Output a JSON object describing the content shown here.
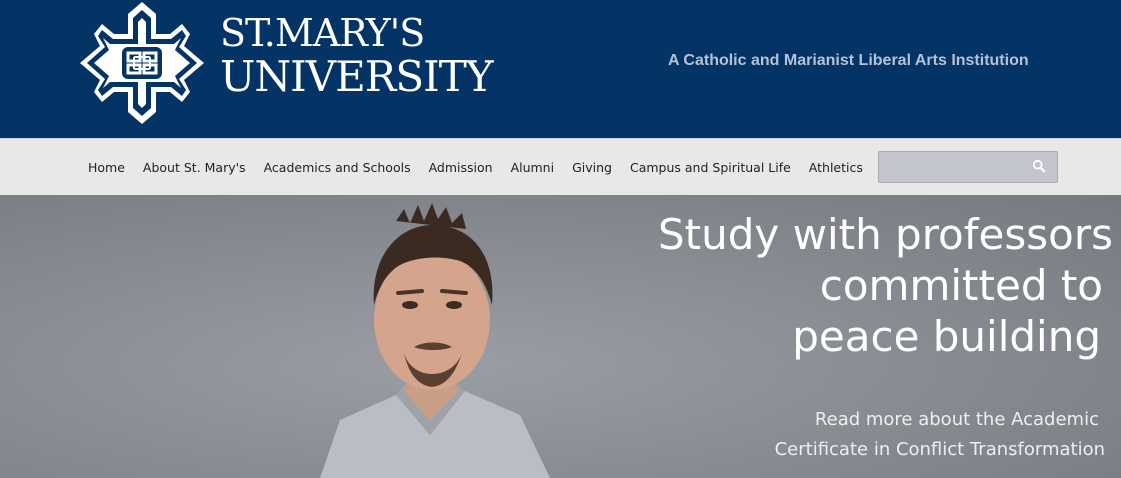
{
  "header": {
    "logo_line1": "ST.MARY'S",
    "logo_line2": "UNIVERSITY",
    "tagline": "A Catholic and Marianist Liberal Arts Institution",
    "crest_icon": "quatrefoil-cross-crest-icon"
  },
  "nav": {
    "items": [
      {
        "label": "Home"
      },
      {
        "label": "About St. Mary's"
      },
      {
        "label": "Academics and Schools"
      },
      {
        "label": "Admission"
      },
      {
        "label": "Alumni"
      },
      {
        "label": "Giving"
      },
      {
        "label": "Campus and Spiritual Life"
      },
      {
        "label": "Athletics"
      }
    ]
  },
  "search": {
    "placeholder": "",
    "value": "",
    "icon": "magnifier-icon"
  },
  "hero": {
    "headline_line1": "Study with professors",
    "headline_line2": "committed to",
    "headline_line3": "peace building",
    "cta_line1": "Read more about the Academic",
    "cta_line2": "Certificate in Conflict Transformation"
  },
  "colors": {
    "brand_navy": "#043366",
    "nav_bg": "#e8e8e8",
    "tagline": "#b3c2d5",
    "hero_bg": "#8a8e94"
  }
}
